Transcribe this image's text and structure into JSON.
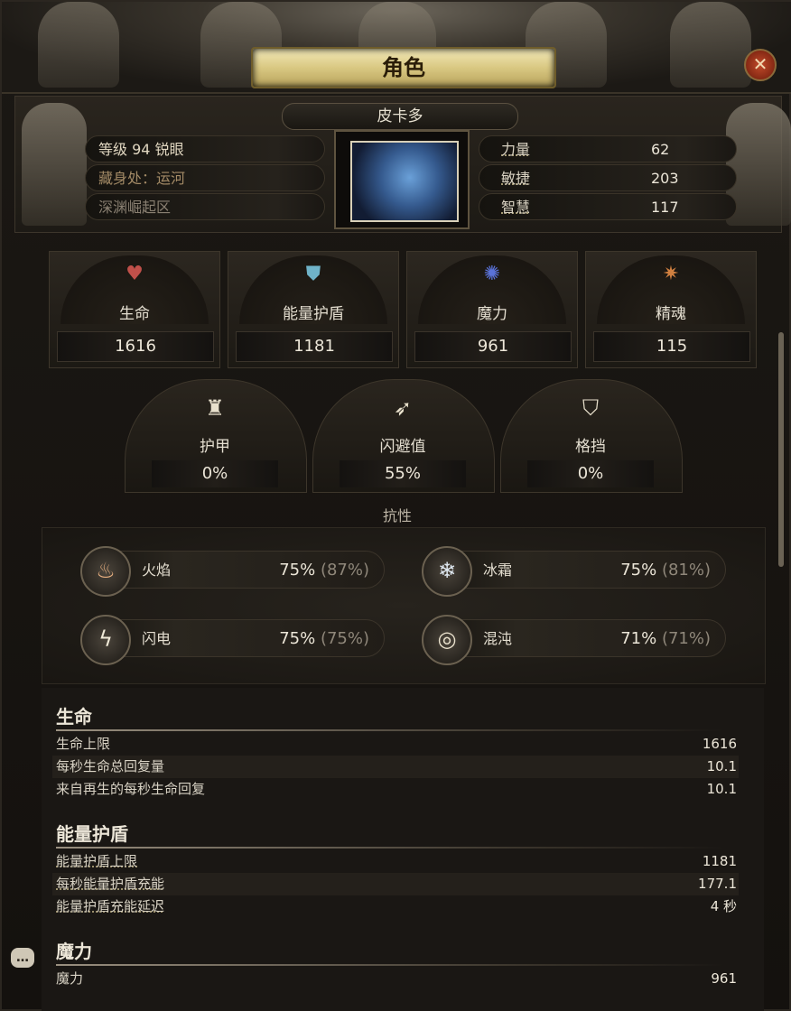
{
  "window": {
    "title": "角色",
    "close_icon": "close-icon"
  },
  "character": {
    "name": "皮卡多",
    "level_label": "等级",
    "level_value": "94",
    "class": "锐眼",
    "hideout_label": "藏身处：运河",
    "zone": "深渊崛起区"
  },
  "attributes": [
    {
      "label": "力量",
      "value": "62"
    },
    {
      "label": "敏捷",
      "value": "203"
    },
    {
      "label": "智慧",
      "value": "117"
    }
  ],
  "main_stats": [
    {
      "label": "生命",
      "value": "1616",
      "icon": "heart-icon",
      "color": "#c0504a"
    },
    {
      "label": "能量护盾",
      "value": "1181",
      "icon": "shield-icon",
      "color": "#6fb3c9"
    },
    {
      "label": "魔力",
      "value": "961",
      "icon": "mana-icon",
      "color": "#5a72d8"
    },
    {
      "label": "精魂",
      "value": "115",
      "icon": "spirit-icon",
      "color": "#d08040"
    }
  ],
  "defences": [
    {
      "label": "护甲",
      "value": "0%",
      "icon": "armour-icon"
    },
    {
      "label": "闪避值",
      "value": "55%",
      "icon": "evasion-icon"
    },
    {
      "label": "格挡",
      "value": "0%",
      "icon": "block-icon"
    }
  ],
  "resistances": {
    "title": "抗性",
    "items": [
      {
        "label": "火焰",
        "value": "75%",
        "max": "(87%)",
        "icon": "fire-icon"
      },
      {
        "label": "冰霜",
        "value": "75%",
        "max": "(81%)",
        "icon": "cold-icon"
      },
      {
        "label": "闪电",
        "value": "75%",
        "max": "(75%)",
        "icon": "lightning-icon"
      },
      {
        "label": "混沌",
        "value": "71%",
        "max": "(71%)",
        "icon": "chaos-icon"
      }
    ]
  },
  "details": {
    "life": {
      "title": "生命",
      "rows": [
        {
          "label": "生命上限",
          "value": "1616"
        },
        {
          "label": "每秒生命总回复量",
          "value": "10.1"
        },
        {
          "label": "来自再生的每秒生命回复",
          "value": "10.1"
        }
      ]
    },
    "energy_shield": {
      "title": "能量护盾",
      "rows": [
        {
          "label": "能量护盾上限",
          "value": "1181"
        },
        {
          "label": "每秒能量护盾充能",
          "value": "177.1"
        },
        {
          "label": "能量护盾充能延迟",
          "value": "4 秒"
        }
      ]
    },
    "mana": {
      "title": "魔力",
      "rows": [
        {
          "label": "魔力",
          "value": "961"
        }
      ]
    }
  },
  "chat_icon": "chat-icon"
}
